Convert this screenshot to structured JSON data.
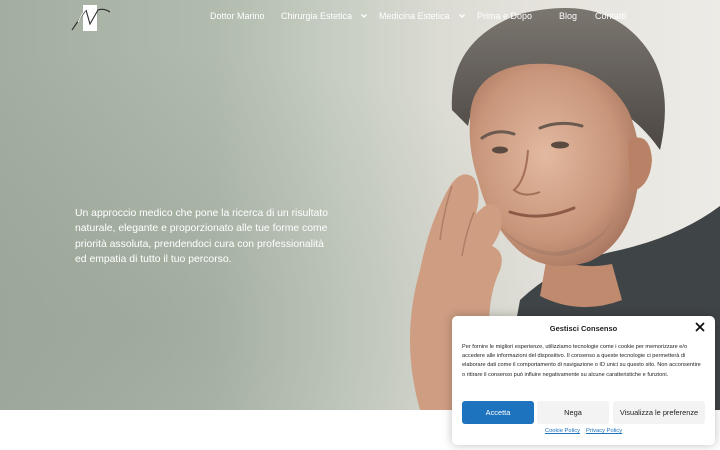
{
  "nav": {
    "items": [
      {
        "label": "Dottor Marino",
        "has_dropdown": false
      },
      {
        "label": "Chirurgia Estetica",
        "has_dropdown": true
      },
      {
        "label": "Medicina Estetica",
        "has_dropdown": true
      },
      {
        "label": "Prima e Dopo",
        "has_dropdown": false
      },
      {
        "label": "Blog",
        "has_dropdown": false
      },
      {
        "label": "Contatti",
        "has_dropdown": false
      }
    ]
  },
  "hero": {
    "tagline": "Un approccio medico che pone la ricerca di un risultato naturale, elegante e proporzionato alle tue forme come priorità assoluta, prendendoci cura con professionalità ed empatia di tutto il tuo percorso."
  },
  "cookie": {
    "title": "Gestisci Consenso",
    "text": "Per fornire le migliori esperienze, utilizziamo tecnologie come i cookie per memorizzare e/o accedere alle informazioni del dispositivo. Il consenso a queste tecnologie ci permetterà di elaborare dati come il comportamento di navigazione o ID unici su questo sito. Non acconsentire o ritirare il consenso può influire negativamente su alcune caratteristiche e funzioni.",
    "accept_label": "Accetta",
    "deny_label": "Nega",
    "prefs_label": "Visualizza le preferenze",
    "cookie_policy_label": "Cookie Policy",
    "privacy_policy_label": "Privacy Policy"
  },
  "colors": {
    "accent": "#1e73be",
    "hero_left": "#a3aea1",
    "hero_right": "#ecebe6"
  }
}
